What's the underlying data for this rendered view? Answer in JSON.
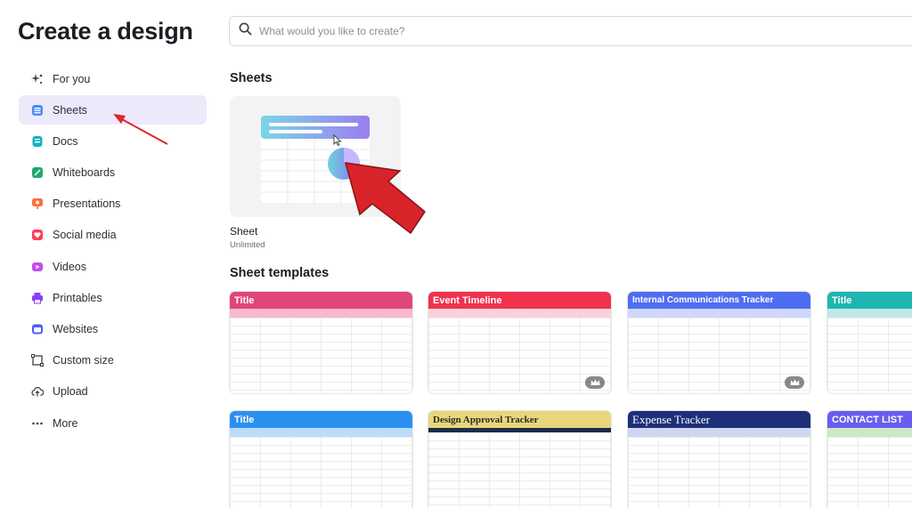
{
  "header": {
    "title": "Create a design",
    "search_placeholder": "What would you like to create?"
  },
  "sidebar": {
    "items": [
      {
        "label": "For you",
        "icon": "sparkle-icon",
        "color": "#3b3f45"
      },
      {
        "label": "Sheets",
        "icon": "sheets-icon",
        "color": "#4a8df8",
        "active": true
      },
      {
        "label": "Docs",
        "icon": "docs-icon",
        "color": "#13b5c1"
      },
      {
        "label": "Whiteboards",
        "icon": "whiteboard-icon",
        "color": "#1fa971"
      },
      {
        "label": "Presentations",
        "icon": "presentation-icon",
        "color": "#ff6b3d"
      },
      {
        "label": "Social media",
        "icon": "heart-icon",
        "color": "#ff3d5a"
      },
      {
        "label": "Videos",
        "icon": "video-icon",
        "color": "#c24ef0"
      },
      {
        "label": "Printables",
        "icon": "printer-icon",
        "color": "#8a3ffc"
      },
      {
        "label": "Websites",
        "icon": "website-icon",
        "color": "#4d5df5"
      },
      {
        "label": "Custom size",
        "icon": "custom-size-icon",
        "color": "#3b3f45"
      },
      {
        "label": "Upload",
        "icon": "upload-icon",
        "color": "#3b3f45"
      },
      {
        "label": "More",
        "icon": "more-icon",
        "color": "#3b3f45"
      }
    ]
  },
  "main": {
    "sheets_section_title": "Sheets",
    "sheet_card": {
      "name": "Sheet",
      "subtitle": "Unlimited"
    },
    "templates_section_title": "Sheet templates",
    "templates": [
      {
        "title": "Title",
        "header_color": "#e0457b",
        "sub_color": "#f6b9cf",
        "premium": false
      },
      {
        "title": "Event Timeline",
        "header_color": "#f0324f",
        "sub_color": "#fbd1d8",
        "premium": true
      },
      {
        "title": "Internal Communications Tracker",
        "header_color": "#4f6df0",
        "sub_color": "#cfd8fb",
        "premium": true
      },
      {
        "title": "Title",
        "header_color": "#1fb5b0",
        "sub_color": "#bfe9e7",
        "premium": false
      },
      {
        "title": "Title",
        "header_color": "#2b8ff0",
        "sub_color": "#bcdcfb",
        "premium": false
      },
      {
        "title": "Design Approval Tracker",
        "header_color": "#e8d77a",
        "sub_color": "#1e2a4a",
        "premium": true
      },
      {
        "title": "Expense Tracker",
        "header_color": "#1e2f7a",
        "sub_color": "#cfd6ef",
        "premium": true
      },
      {
        "title": "CONTACT LIST",
        "header_color": "#6a5cf0",
        "sub_color": "#cbe9c2",
        "premium": false
      }
    ]
  },
  "annotations": {
    "arrow_color": "#e0262b"
  }
}
